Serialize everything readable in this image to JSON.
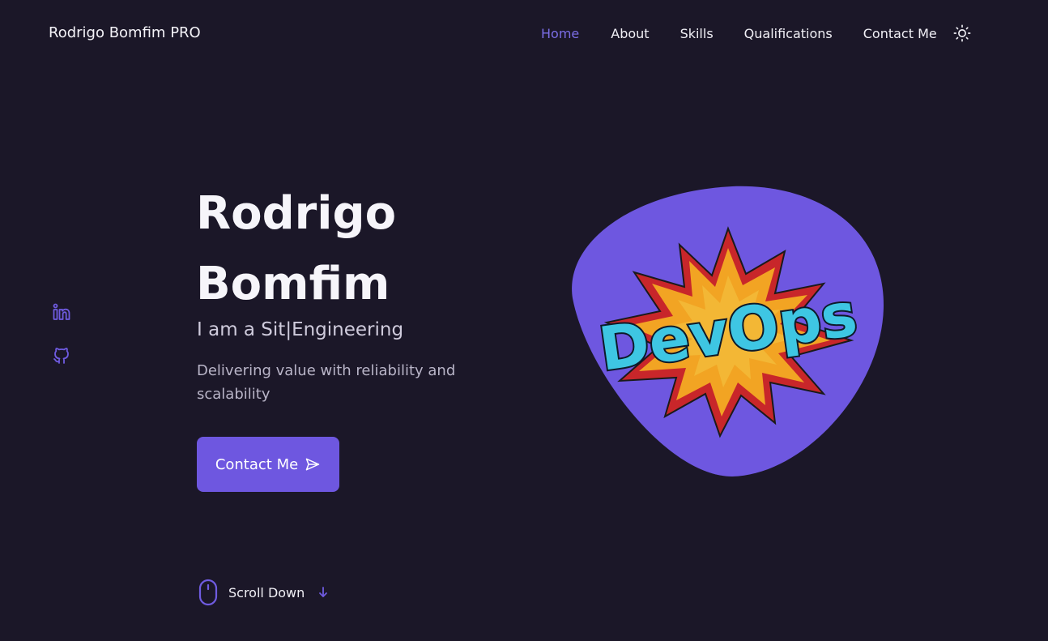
{
  "header": {
    "logo": "Rodrigo Bomfim PRO",
    "nav": {
      "home": "Home",
      "about": "About",
      "skills": "Skills",
      "qualifications": "Qualifications",
      "contact": "Contact Me"
    },
    "theme_icon": "sun-icon"
  },
  "social": {
    "linkedin_icon": "linkedin-icon",
    "github_icon": "github-icon"
  },
  "hero": {
    "title_line1": "Rodrigo",
    "title_line2": "Bomfim",
    "subtitle": "I am a Sit|Engineering",
    "description": "Delivering value with reliability and scalability",
    "cta_label": "Contact Me",
    "cta_icon": "send-icon",
    "image_text": "DevOps"
  },
  "scroll": {
    "label": "Scroll Down",
    "mouse_icon": "mouse-icon",
    "arrow_icon": "arrow-down-icon"
  },
  "colors": {
    "background": "#1b1728",
    "accent": "#6e57e0",
    "text": "#f2f0f7"
  }
}
